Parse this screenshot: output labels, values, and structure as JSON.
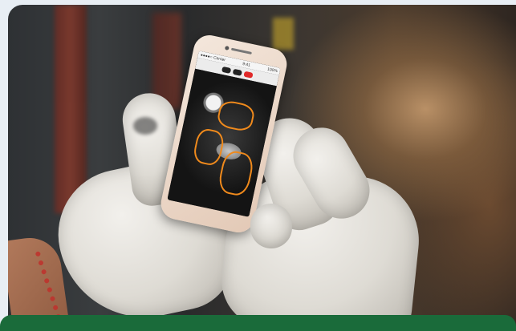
{
  "image": {
    "subject": "gloved-hands-holding-phone",
    "phone_screen": {
      "status_left": "●●●●○ Carrier",
      "status_time": "9:41",
      "status_right": "100%"
    }
  },
  "colors": {
    "page_background": "#e8eef4",
    "banner_green": "#1a6b3a",
    "record_red": "#e02828",
    "wire_orange": "#f08a1c"
  }
}
